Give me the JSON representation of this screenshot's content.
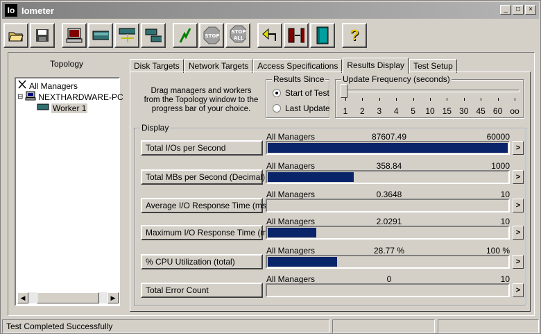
{
  "window": {
    "title": "Iometer",
    "icon_text": "Io"
  },
  "title_buttons": [
    "_",
    "□",
    "×"
  ],
  "toolbar": [
    {
      "name": "open-config-icon",
      "glyph": "📂"
    },
    {
      "name": "save-config-icon",
      "glyph": "💾"
    },
    {
      "name": "new-manager-icon",
      "glyph": "▣"
    },
    {
      "name": "new-disk-worker-icon",
      "glyph": "▬"
    },
    {
      "name": "new-network-worker-icon",
      "glyph": "⊞"
    },
    {
      "name": "duplicate-worker-icon",
      "glyph": "⧉"
    },
    {
      "name": "start-tests-icon",
      "glyph": "⚡"
    },
    {
      "name": "stop-icon",
      "glyph": "STOP"
    },
    {
      "name": "stop-all-icon",
      "glyph": "STOP ALL"
    },
    {
      "name": "reset-workers-icon",
      "glyph": "↶"
    },
    {
      "name": "exit-icon",
      "glyph": "⇄"
    },
    {
      "name": "quit-door-icon",
      "glyph": "🚪"
    },
    {
      "name": "help-icon",
      "glyph": "?"
    }
  ],
  "topology": {
    "title": "Topology",
    "items": [
      "All Managers",
      "NEXTHARDWARE-PC",
      "Worker 1"
    ],
    "scroll_left": "◀",
    "scroll_right": "▶"
  },
  "tabs": [
    "Disk Targets",
    "Network Targets",
    "Access Specifications",
    "Results Display",
    "Test Setup"
  ],
  "instructions": "Drag managers and workers from the Topology window to the progress bar of your choice.",
  "results_since": {
    "title": "Results Since",
    "options": [
      "Start of Test",
      "Last Update"
    ],
    "selected": "Start of Test"
  },
  "update_frequency": {
    "title": "Update Frequency (seconds)",
    "ticks": [
      "1",
      "2",
      "3",
      "4",
      "5",
      "10",
      "15",
      "30",
      "45",
      "60",
      "oo"
    ]
  },
  "display": {
    "title": "Display",
    "arrow": ">",
    "metrics": [
      {
        "label": "Total I/Os per Second",
        "source": "All Managers",
        "value": "87607.49",
        "max": "60000",
        "fill": 1.0
      },
      {
        "label": "Total MBs per Second (Decimal)",
        "source": "All Managers",
        "value": "358.84",
        "max": "1000",
        "fill": 0.3588
      },
      {
        "label": "Average I/O Response Time (ms)",
        "source": "All Managers",
        "value": "0.3648",
        "max": "10",
        "fill": 0.0
      },
      {
        "label": "Maximum I/O Response Time (ms)",
        "source": "All Managers",
        "value": "2.0291",
        "max": "10",
        "fill": 0.2029
      },
      {
        "label": "% CPU Utilization (total)",
        "source": "All Managers",
        "value": "28.77 %",
        "max": "100 %",
        "fill": 0.2877
      },
      {
        "label": "Total Error Count",
        "source": "All Managers",
        "value": "0",
        "max": "10",
        "fill": 0.0
      }
    ]
  },
  "status_bar": {
    "message": "Test Completed Successfully"
  },
  "colors": {
    "bar_fill": "#0a246a",
    "title_bar": "#808080"
  }
}
